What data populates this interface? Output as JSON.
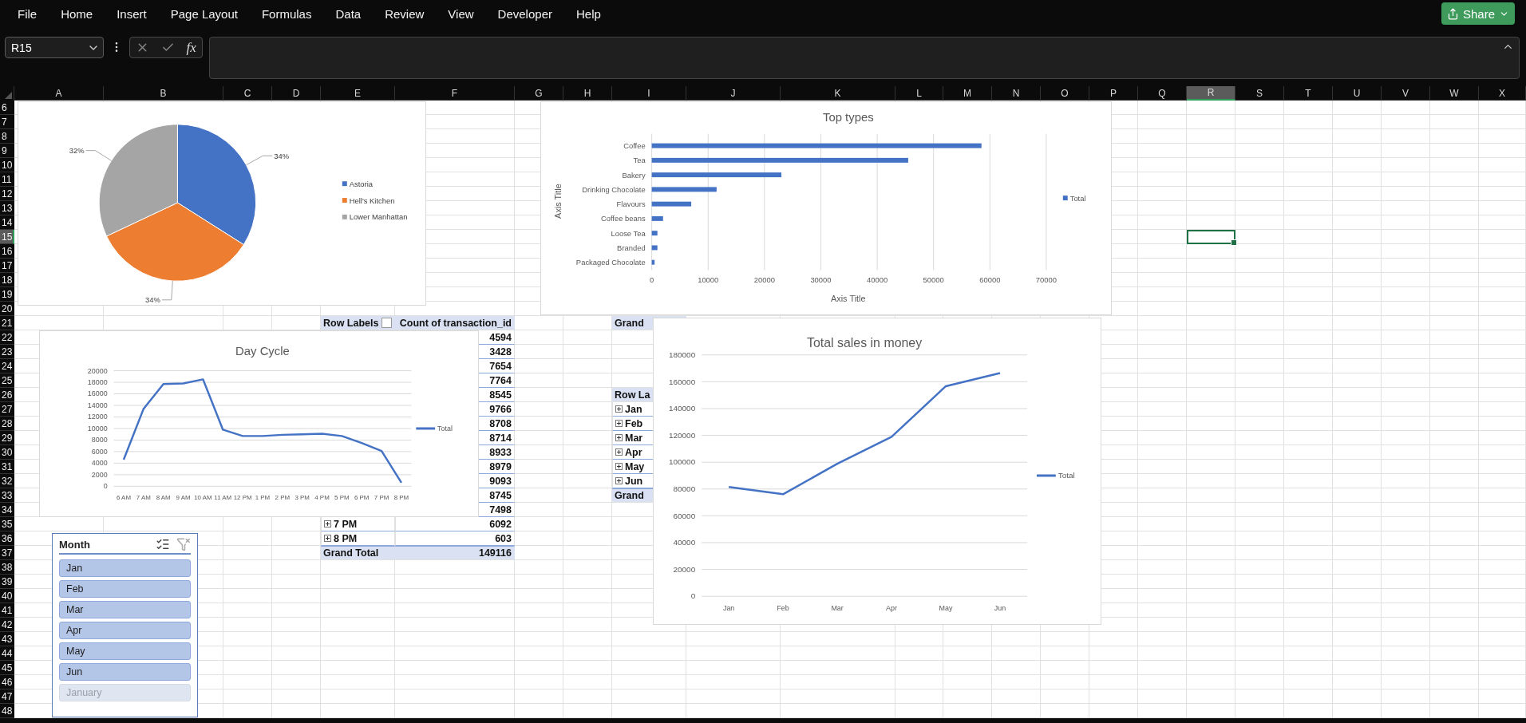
{
  "menu_bar": {
    "items": [
      "File",
      "Home",
      "Insert",
      "Page Layout",
      "Formulas",
      "Data",
      "Review",
      "View",
      "Developer",
      "Help"
    ],
    "share_button": "Share"
  },
  "formula_bar": {
    "name_box": "R15",
    "function_label": "fx"
  },
  "sheet": {
    "columns": [
      {
        "label": "A",
        "selected": false
      },
      {
        "label": "B",
        "selected": false
      },
      {
        "label": "C",
        "selected": false
      },
      {
        "label": "D",
        "selected": false
      },
      {
        "label": "E",
        "selected": false
      },
      {
        "label": "F",
        "selected": false
      },
      {
        "label": "G",
        "selected": false
      },
      {
        "label": "H",
        "selected": false
      },
      {
        "label": "I",
        "selected": false
      },
      {
        "label": "J",
        "selected": false
      },
      {
        "label": "K",
        "selected": false
      },
      {
        "label": "L",
        "selected": false
      },
      {
        "label": "M",
        "selected": false
      },
      {
        "label": "N",
        "selected": false
      },
      {
        "label": "O",
        "selected": false
      },
      {
        "label": "P",
        "selected": false
      },
      {
        "label": "Q",
        "selected": false
      },
      {
        "label": "R",
        "selected": true
      },
      {
        "label": "S",
        "selected": false
      },
      {
        "label": "T",
        "selected": false
      },
      {
        "label": "U",
        "selected": false
      },
      {
        "label": "V",
        "selected": false
      },
      {
        "label": "W",
        "selected": false
      },
      {
        "label": "X",
        "selected": false
      }
    ],
    "rows": [
      {
        "label": "6",
        "selected": false
      },
      {
        "label": "7",
        "selected": false
      },
      {
        "label": "8",
        "selected": false
      },
      {
        "label": "9",
        "selected": false
      },
      {
        "label": "10",
        "selected": false
      },
      {
        "label": "11",
        "selected": false
      },
      {
        "label": "12",
        "selected": false
      },
      {
        "label": "13",
        "selected": false
      },
      {
        "label": "14",
        "selected": false
      },
      {
        "label": "15",
        "selected": true
      },
      {
        "label": "16",
        "selected": false
      },
      {
        "label": "17",
        "selected": false
      },
      {
        "label": "18",
        "selected": false
      },
      {
        "label": "19",
        "selected": false
      },
      {
        "label": "20",
        "selected": false
      },
      {
        "label": "21",
        "selected": false
      },
      {
        "label": "22",
        "selected": false
      },
      {
        "label": "23",
        "selected": false
      },
      {
        "label": "24",
        "selected": false
      },
      {
        "label": "25",
        "selected": false
      },
      {
        "label": "26",
        "selected": false
      },
      {
        "label": "27",
        "selected": false
      },
      {
        "label": "28",
        "selected": false
      },
      {
        "label": "29",
        "selected": false
      },
      {
        "label": "30",
        "selected": false
      },
      {
        "label": "31",
        "selected": false
      },
      {
        "label": "32",
        "selected": false
      },
      {
        "label": "33",
        "selected": false
      },
      {
        "label": "34",
        "selected": false
      },
      {
        "label": "35",
        "selected": false
      },
      {
        "label": "36",
        "selected": false
      },
      {
        "label": "37",
        "selected": false
      },
      {
        "label": "38",
        "selected": false
      },
      {
        "label": "39",
        "selected": false
      },
      {
        "label": "40",
        "selected": false
      },
      {
        "label": "41",
        "selected": false
      },
      {
        "label": "42",
        "selected": false
      },
      {
        "label": "43",
        "selected": false
      },
      {
        "label": "44",
        "selected": false
      },
      {
        "label": "45",
        "selected": false
      },
      {
        "label": "46",
        "selected": false
      },
      {
        "label": "47",
        "selected": false
      },
      {
        "label": "48",
        "selected": false
      }
    ],
    "pivot_hours": {
      "headers": [
        "Row Labels",
        "Count of transaction_id"
      ],
      "rows": [
        {
          "value": "4594"
        },
        {
          "value": "3428"
        },
        {
          "value": "7654"
        },
        {
          "value": "7764"
        },
        {
          "value": "8545"
        },
        {
          "value": "9766"
        },
        {
          "value": "8708"
        },
        {
          "value": "8714"
        },
        {
          "value": "8933"
        },
        {
          "value": "8979"
        },
        {
          "value": "9093"
        },
        {
          "value": "8745"
        },
        {
          "value": "7498"
        },
        {
          "label": "7 PM",
          "value": "6092"
        },
        {
          "label": "8 PM",
          "value": "603"
        }
      ],
      "grand_total": {
        "label": "Grand Total",
        "value": "149116"
      }
    },
    "pivot_months": {
      "header": "Grand",
      "row_header": "Row La",
      "items": [
        "Jan",
        "Feb",
        "Mar",
        "Apr",
        "May",
        "Jun"
      ],
      "grand_total": "Grand"
    }
  },
  "pie_chart": {
    "slices": [
      {
        "color": "#4472c4"
      },
      {
        "color": "#ed7d31"
      },
      {
        "color": "#a5a5a5"
      }
    ],
    "chart_data": {
      "type": "pie",
      "categories": [
        "Astoria",
        "Hell's Kitchen",
        "Lower Manhattan"
      ],
      "values": [
        34,
        34,
        32
      ],
      "value_labels": [
        "34%",
        "34%",
        "32%"
      ],
      "legend": true
    }
  },
  "bar_chart": {
    "chart_data": {
      "type": "bar",
      "orientation": "horizontal",
      "title": "Top types",
      "xlabel": "Axis Title",
      "ylabel": "Axis Title",
      "categories": [
        "Coffee",
        "Tea",
        "Bakery",
        "Drinking Chocolate",
        "Flavours",
        "Coffee beans",
        "Loose Tea",
        "Branded",
        "Packaged Chocolate"
      ],
      "series": [
        {
          "name": "Total",
          "color": "#4472c4",
          "values": [
            58500,
            45500,
            23000,
            11500,
            7000,
            2000,
            1000,
            1000,
            500
          ]
        }
      ],
      "xlim": [
        0,
        70000
      ],
      "xticks": [
        0,
        10000,
        20000,
        30000,
        40000,
        50000,
        60000,
        70000
      ],
      "grid": true,
      "legend": true
    }
  },
  "day_cycle_chart": {
    "chart_data": {
      "type": "line",
      "title": "Day Cycle",
      "categories": [
        "6 AM",
        "7 AM",
        "8 AM",
        "9 AM",
        "10 AM",
        "11 AM",
        "12 PM",
        "1 PM",
        "2 PM",
        "3 PM",
        "4 PM",
        "5 PM",
        "6 PM",
        "7 PM",
        "8 PM"
      ],
      "series": [
        {
          "name": "Total",
          "color": "#4472c4",
          "values": [
            4600,
            13400,
            17700,
            17800,
            18500,
            9800,
            8700,
            8700,
            8900,
            9000,
            9100,
            8700,
            7500,
            6100,
            600
          ]
        }
      ],
      "ylim": [
        0,
        20000
      ],
      "yticks": [
        0,
        2000,
        4000,
        6000,
        8000,
        10000,
        12000,
        14000,
        16000,
        18000,
        20000
      ],
      "grid": true,
      "legend": true
    }
  },
  "sales_chart": {
    "chart_data": {
      "type": "line",
      "title": "Total sales in money",
      "categories": [
        "Jan",
        "Feb",
        "Mar",
        "Apr",
        "May",
        "Jun"
      ],
      "series": [
        {
          "name": "Total",
          "color": "#4472c4",
          "values": [
            81500,
            76100,
            98800,
            118900,
            156700,
            166500
          ]
        }
      ],
      "ylim": [
        0,
        180000
      ],
      "yticks": [
        0,
        20000,
        40000,
        60000,
        80000,
        100000,
        120000,
        140000,
        160000,
        180000
      ],
      "grid": true,
      "legend": true
    }
  },
  "slicer": {
    "title": "Month",
    "items": [
      {
        "label": "Jan",
        "selected": true
      },
      {
        "label": "Feb",
        "selected": true
      },
      {
        "label": "Mar",
        "selected": true
      },
      {
        "label": "Apr",
        "selected": true
      },
      {
        "label": "May",
        "selected": true
      },
      {
        "label": "Jun",
        "selected": true
      },
      {
        "label": "January",
        "selected": false
      }
    ]
  }
}
